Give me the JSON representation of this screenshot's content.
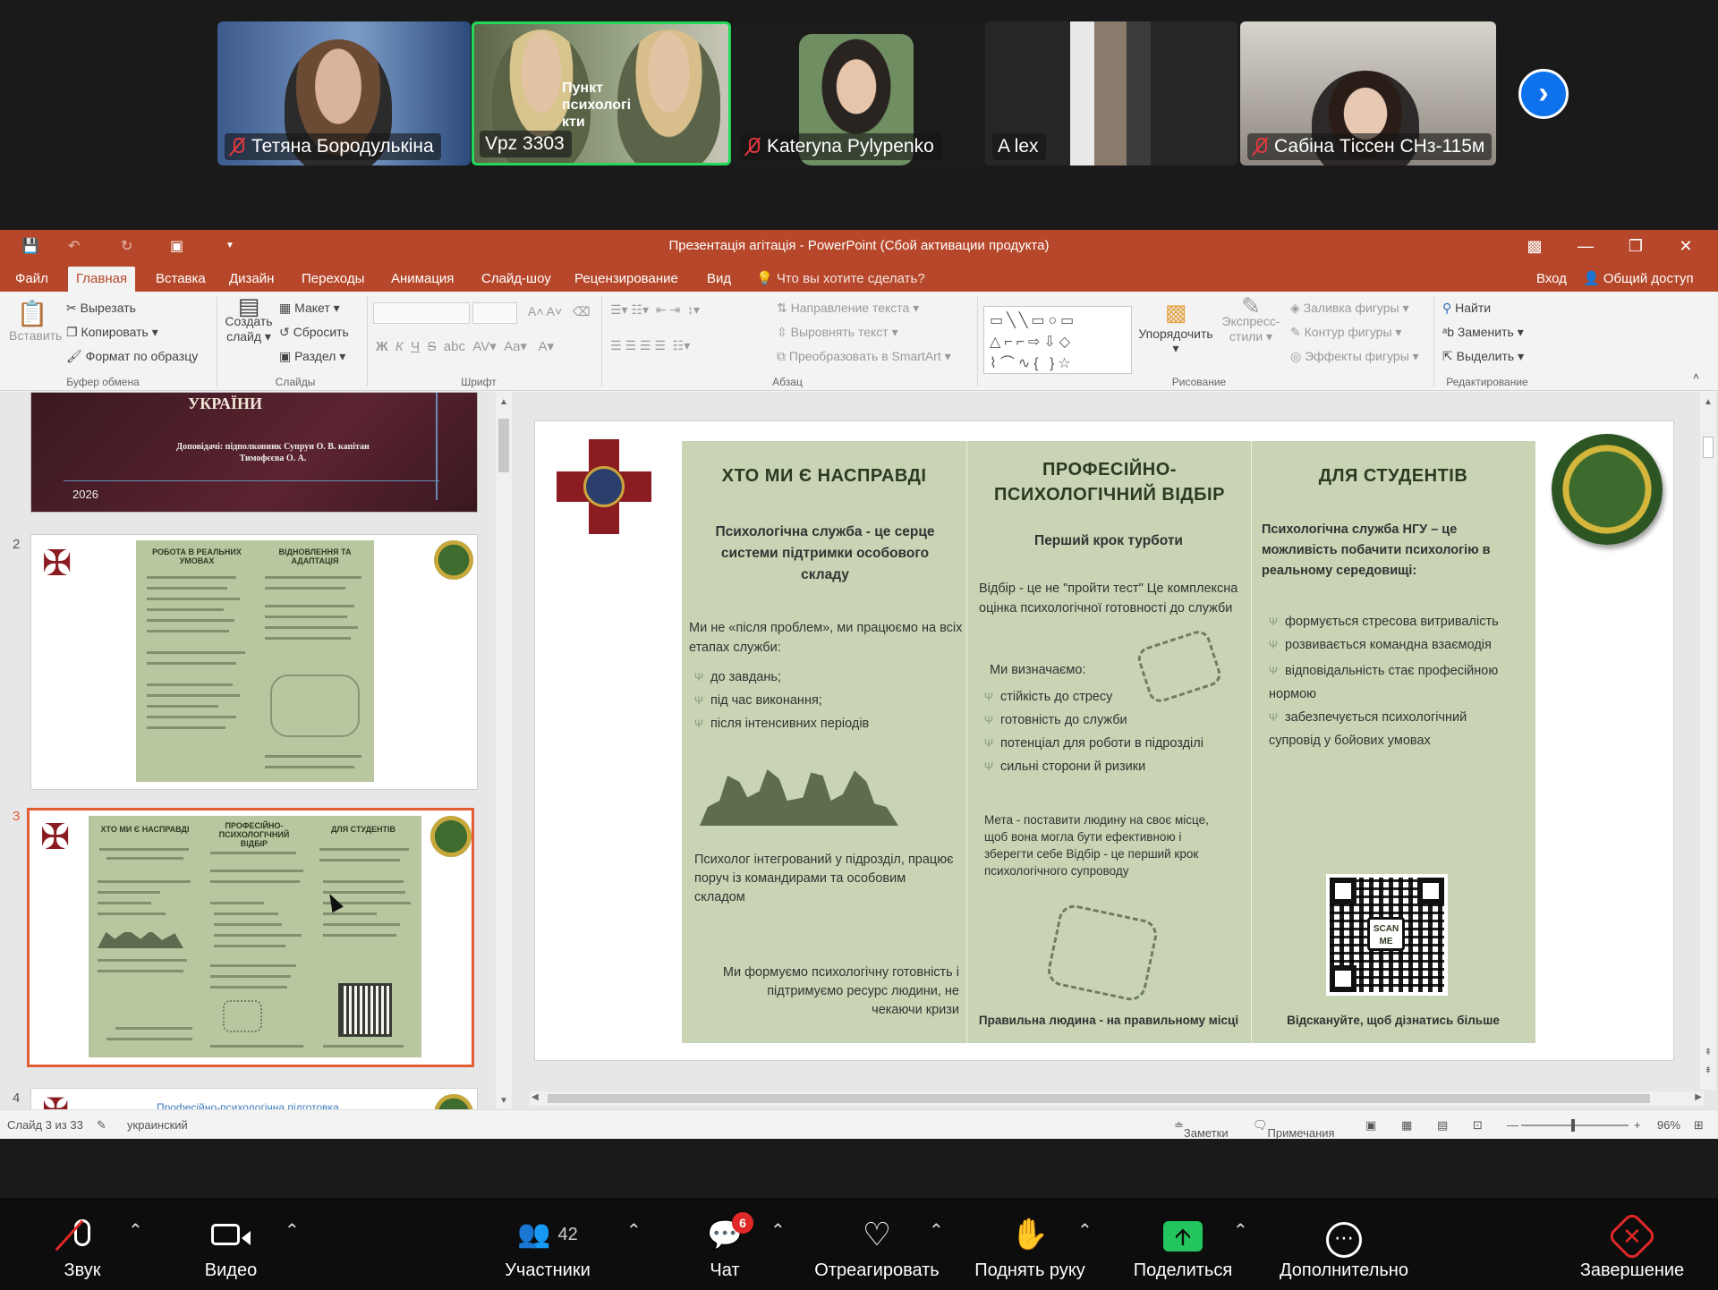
{
  "participants": [
    {
      "name": "Тетяна Бородулькіна",
      "muted": true
    },
    {
      "name": "Vpz 3303",
      "muted": false,
      "active": true,
      "overlay_text": "Пункт психологі кти"
    },
    {
      "name": "Kateryna Pylypenko",
      "muted": true
    },
    {
      "name": "A lex",
      "muted": false
    },
    {
      "name": "Сабіна Тіссен СНз-115м",
      "muted": true
    }
  ],
  "ppt": {
    "window_title": "Презентація агітація - PowerPoint (Сбой активации продукта)",
    "tabs": [
      "Файл",
      "Главная",
      "Вставка",
      "Дизайн",
      "Переходы",
      "Анимация",
      "Слайд-шоу",
      "Рецензирование",
      "Вид"
    ],
    "active_tab": "Главная",
    "tell_me": "Что вы хотите сделать?",
    "login": "Вход",
    "share": "Общий доступ",
    "ribbon": {
      "paste": "Вставить",
      "cut": "Вырезать",
      "copy": "Копировать",
      "format_painter": "Формат по образцу",
      "clipboard_group": "Буфер обмена",
      "new_slide": "Создать слайд",
      "layout": "Макет",
      "reset": "Сбросить",
      "section": "Раздел",
      "slides_group": "Слайды",
      "font_group": "Шрифт",
      "text_direction": "Направление текста",
      "align_text": "Выровнять текст",
      "smartart": "Преобразовать в SmartArt",
      "paragraph_group": "Абзац",
      "arrange": "Упорядочить",
      "quick_styles": "Экспресс-стили",
      "shape_fill": "Заливка фигуры",
      "shape_outline": "Контур фигуры",
      "shape_effects": "Эффекты фигуры",
      "drawing_group": "Рисование",
      "find": "Найти",
      "replace": "Заменить",
      "select": "Выделить",
      "editing_group": "Редактирование"
    },
    "thumbnails": {
      "slide1_title": "УКРАЇНИ",
      "slide1_speakers": "Доповідачі: підполковник Супрун О. В. капітан Тимофєєва О. А.",
      "slide1_year": "2026",
      "slide2_num": "2",
      "slide2_h1": "РОБОТА В РЕАЛЬНИХ УМОВАХ",
      "slide2_h2": "ВІДНОВЛЕННЯ ТА АДАПТАЦІЯ",
      "slide3_num": "3",
      "slide3_h1": "ХТО МИ Є НАСПРАВДІ",
      "slide3_h2": "ПРОФЕСІЙНО-ПСИХОЛОГІЧНИЙ ВІДБІР",
      "slide3_h3": "ДЛЯ СТУДЕНТІВ",
      "slide4_num": "4",
      "slide4_title": "Професійно-психологічна підготовка"
    },
    "slide": {
      "col1": {
        "title": "ХТО МИ Є НАСПРАВДІ",
        "lead": "Психологічна служба - це серце системи підтримки особового складу",
        "intro": "Ми не «після проблем», ми працюємо на всіх етапах служби:",
        "bullets": [
          "до завдань;",
          "під час виконання;",
          "після інтенсивних періодів"
        ],
        "integrated": "Психолог інтегрований у підрозділ, працює поруч із командирами та особовим складом",
        "closing": "Ми формуємо психологічну готовність і підтримуємо ресурс людини, не чекаючи кризи"
      },
      "col2": {
        "title": "ПРОФЕСІЙНО-ПСИХОЛОГІЧНИЙ ВІДБІР",
        "subtitle": "Перший крок турботи",
        "intro": "Відбір - це не \"пройти тест\" Це комплексна оцінка психологічної готовності до служби",
        "define": "Ми визначаємо:",
        "bullets": [
          "стійкість до стресу",
          "готовність до служби",
          "потенціал для роботи в підрозділі",
          "сильні сторони й ризики"
        ],
        "goal": "Мета - поставити людину на своє місце, щоб вона могла бути ефективною і зберегти себе Відбір - це перший крок психологічного супроводу",
        "footer": "Правильна людина - на правильному місці"
      },
      "col3": {
        "title": "ДЛЯ СТУДЕНТІВ",
        "lead": "Психологічна служба НГУ – це можливість побачити психологію в реальному середовищі:",
        "bullets": [
          "формується стресова витривалість",
          "розвивається командна взаємодія",
          "відповідальність стає професійною нормою",
          "забезпечується психологічний супровід у бойових умовах"
        ],
        "qr_label": "SCAN ME",
        "footer": "Відскануйте, щоб дізнатись більше"
      }
    },
    "status": {
      "slide_of": "Слайд 3 из 33",
      "language": "украинский",
      "notes": "Заметки",
      "comments": "Примечания",
      "zoom": "96%"
    }
  },
  "toolbar": {
    "audio": "Звук",
    "video": "Видео",
    "participants": "Участники",
    "participants_count": "42",
    "chat": "Чат",
    "chat_badge": "6",
    "react": "Отреагировать",
    "raise_hand": "Поднять руку",
    "share": "Поделиться",
    "more": "Дополнительно",
    "end": "Завершение"
  },
  "colors": {
    "ppt_accent": "#b7472a",
    "slide_panel": "#c8d4b4",
    "zoom_blue": "#0e72ed",
    "active_speaker": "#23d959",
    "end_red": "#e02828"
  }
}
